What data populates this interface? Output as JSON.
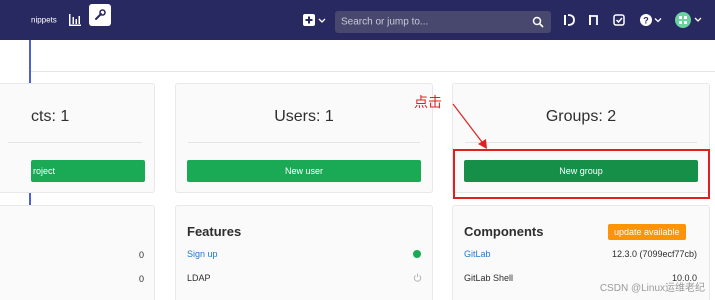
{
  "nav": {
    "snippets_label": "nippets",
    "search_placeholder": "Search or jump to...",
    "icons": [
      "chart-icon",
      "wrench-icon",
      "plus-icon",
      "search-icon",
      "merge-request-icon",
      "issues-icon",
      "todo-icon",
      "help-icon",
      "avatar"
    ]
  },
  "cards": {
    "projects": {
      "title": "cts: 1",
      "button": "roject"
    },
    "users": {
      "title": "Users: 1",
      "button": "New user"
    },
    "groups": {
      "title": "Groups: 2",
      "button": "New group"
    }
  },
  "stats": {
    "values": [
      "0",
      "0"
    ]
  },
  "features": {
    "title": "Features",
    "items": [
      {
        "label": "Sign up",
        "status": "enabled"
      },
      {
        "label": "LDAP",
        "status": "off"
      }
    ]
  },
  "components": {
    "title": "Components",
    "badge": "update available",
    "items": [
      {
        "label": "GitLab",
        "value": "12.3.0 (7099ecf77cb)"
      },
      {
        "label": "GitLab Shell",
        "value": "10.0.0"
      }
    ]
  },
  "annotation": {
    "text": "点击"
  },
  "watermark": "CSDN @Linux运维老纪",
  "colors": {
    "navbar": "#292961",
    "primary_button": "#1aaa55",
    "highlight": "#e02020",
    "badge": "#fc9403",
    "link": "#1f78d1"
  }
}
